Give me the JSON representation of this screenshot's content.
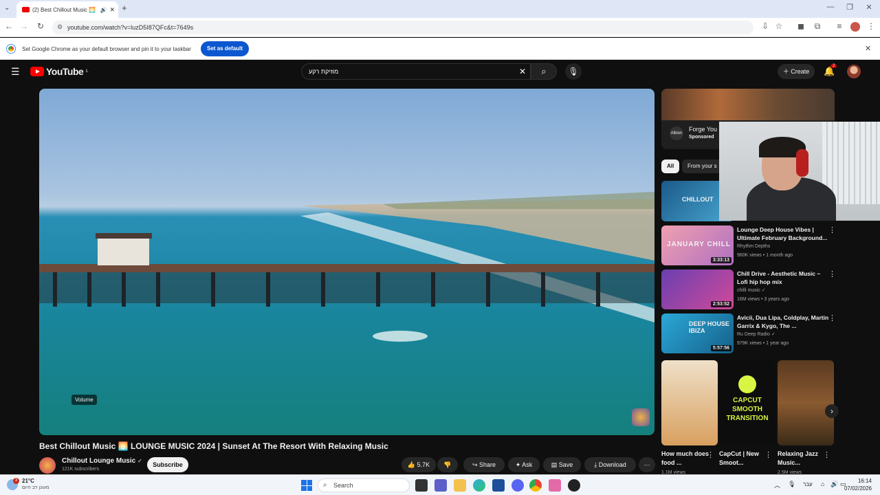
{
  "browser": {
    "tab_title": "(2) Best Chillout Music 🌅 L",
    "url": "youtube.com/watch?v=luzD5I87QFc&t=7649s",
    "infobar_text": "Set Google Chrome as your default browser and pin it to your taskbar",
    "set_default_label": "Set as default"
  },
  "youtube": {
    "logo_text": "YouTube",
    "logo_country": "IL",
    "search_value": "מוזיקת רקע",
    "create_label": "Create",
    "notifications_count": "2"
  },
  "video": {
    "volume_tooltip": "Volume",
    "title": "Best Chillout Music 🌅 LOUNGE MUSIC 2024 | Sunset At The Resort With Relaxing Music",
    "channel": "Chillout Lounge Music",
    "subscribers": "121K subscribers",
    "subscribe_label": "Subscribe",
    "likes": "5.7K",
    "share_label": "Share",
    "ask_label": "Ask",
    "save_label": "Save",
    "download_label": "Download"
  },
  "sidebar": {
    "ad": {
      "title": "Forge You",
      "sponsored": "Sponsored",
      "logo": "Albion"
    },
    "chips": [
      "All",
      "From your s"
    ],
    "first_thumb": {
      "text": "CHILLOUT",
      "duration": "3:"
    },
    "videos": [
      {
        "thumb_text": "JANUARY CHILL",
        "duration": "3:33:13",
        "title": "Lounge Deep House Vibes | Ultimate February Background...",
        "channel": "Rhythm Depths",
        "meta": "960K views • 1 month ago",
        "colors": [
          "#f0a0b0",
          "#b070c0"
        ]
      },
      {
        "thumb_text": "",
        "duration": "2:53:52",
        "title": "Chill Drive - Aesthetic Music ~ Lofi hip hop mix",
        "channel": "chilli music",
        "meta": "16M views • 3 years ago",
        "colors": [
          "#6a3fb0",
          "#d04a9a"
        ]
      },
      {
        "thumb_text": "DEEP HOUSE IBIZA",
        "duration": "5:57:56",
        "title": "Avicii, Dua Lipa, Coldplay, Martin Garrix & Kygo, The ...",
        "channel": "Ru Deep Radio",
        "meta": "979K views • 1 year ago",
        "colors": [
          "#2aa8d8",
          "#16608a"
        ]
      }
    ],
    "shorts": [
      {
        "title": "How much does food ...",
        "views": "1.1M views",
        "overlay": ""
      },
      {
        "title": "CapCut | New Smoot...",
        "views": "",
        "overlay": "CAPCUT SMOOTH TRANSITION"
      },
      {
        "title": "Relaxing Jazz Music...",
        "views": "2.5M views",
        "overlay": ""
      }
    ]
  },
  "taskbar": {
    "weather_temp": "21°C",
    "weather_desc": "מעונן רב היום",
    "weather_badge": "3",
    "search_label": "Search",
    "lang": "עבר",
    "time": "16:14",
    "date": "07/02/2026"
  }
}
